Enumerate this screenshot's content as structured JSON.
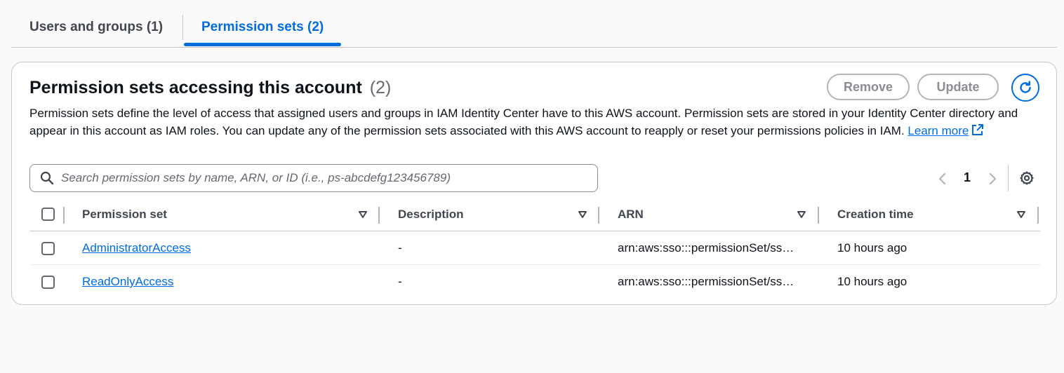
{
  "tabs": [
    {
      "label": "Users and groups (1)",
      "active": false
    },
    {
      "label": "Permission sets (2)",
      "active": true
    }
  ],
  "panel": {
    "title": "Permission sets accessing this account",
    "count": "(2)",
    "description": "Permission sets define the level of access that assigned users and groups in IAM Identity Center have to this AWS account. Permission sets are stored in your Identity Center directory and appear in this account as IAM roles. You can update any of the permission sets associated with this AWS account to reapply or reset your permissions policies in IAM.",
    "learn_more": "Learn more"
  },
  "buttons": {
    "remove": "Remove",
    "update": "Update"
  },
  "search": {
    "placeholder": "Search permission sets by name, ARN, or ID (i.e., ps-abcdefg123456789)"
  },
  "pagination": {
    "current_page": "1"
  },
  "table": {
    "columns": [
      "Permission set",
      "Description",
      "ARN",
      "Creation time"
    ],
    "rows": [
      {
        "name": "AdministratorAccess",
        "description": "-",
        "arn": "arn:aws:sso:::permissionSet/ss…",
        "created": "10 hours ago"
      },
      {
        "name": "ReadOnlyAccess",
        "description": "-",
        "arn": "arn:aws:sso:::permissionSet/ss…",
        "created": "10 hours ago"
      }
    ]
  },
  "colors": {
    "accent": "#006ce0",
    "disabled_border": "#b4b4bb",
    "text": "#0f141a",
    "muted": "#656871"
  },
  "icons": [
    "refresh-icon",
    "search-icon",
    "chevron-left-icon",
    "chevron-right-icon",
    "settings-icon",
    "sort-icon",
    "external-link-icon"
  ]
}
